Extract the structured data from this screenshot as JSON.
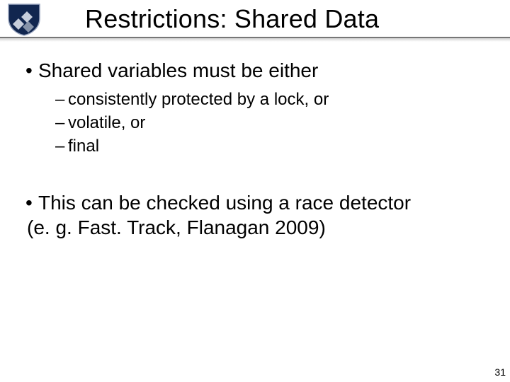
{
  "title": "Restrictions: Shared Data",
  "bullets": [
    {
      "text": "Shared variables must be either",
      "subs": [
        "consistently protected by a lock, or",
        "volatile, or",
        "final"
      ]
    },
    {
      "text": "This can be checked using a race detector (e. g. Fast. Track, Flanagan 2009)",
      "subs": []
    }
  ],
  "page_number": "31"
}
